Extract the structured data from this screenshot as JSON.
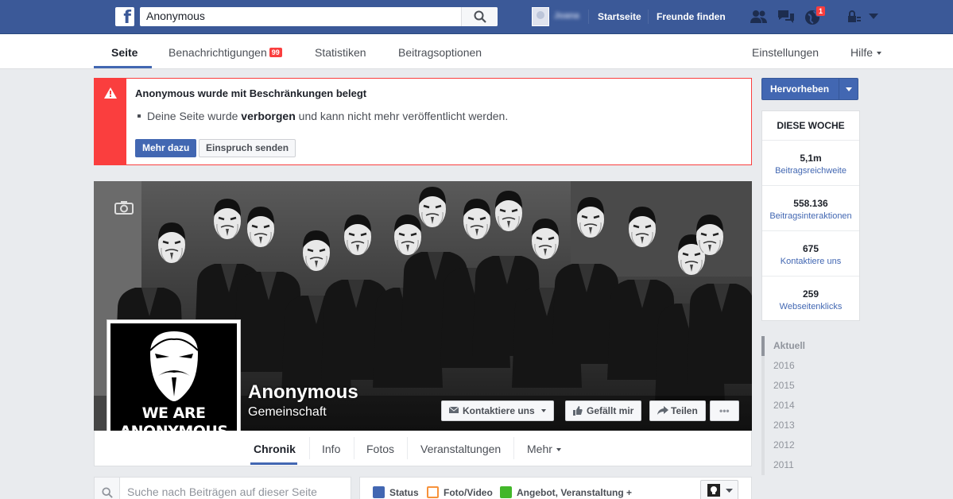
{
  "topbar": {
    "search_value": "Anonymous",
    "user_name": "Joana",
    "nav_home": "Startseite",
    "nav_friends": "Freunde finden",
    "notif_count": "1"
  },
  "page_nav": {
    "tabs": [
      {
        "label": "Seite"
      },
      {
        "label": "Benachrichtigungen",
        "badge": "99"
      },
      {
        "label": "Statistiken"
      },
      {
        "label": "Beitragsoptionen"
      }
    ],
    "settings": "Einstellungen",
    "help": "Hilfe"
  },
  "alert": {
    "title": "Anonymous wurde mit Beschränkungen belegt",
    "text_before": "Deine Seite wurde ",
    "text_bold": "verborgen",
    "text_after": " und kann nicht mehr veröffentlicht werden.",
    "more_button": "Mehr dazu",
    "appeal_button": "Einspruch senden"
  },
  "profile": {
    "picture_text_line1": "WE ARE",
    "picture_text_line2": "ANONYMOUS",
    "name": "Anonymous",
    "category": "Gemeinschaft"
  },
  "cover_actions": {
    "contact": "Kontaktiere uns",
    "like": "Gefällt mir",
    "share": "Teilen",
    "more": "•••"
  },
  "page_tabs": [
    "Chronik",
    "Info",
    "Fotos",
    "Veranstaltungen",
    "Mehr"
  ],
  "search_posts": {
    "placeholder": "Suche nach Beiträgen auf dieser Seite"
  },
  "composer": {
    "status": "Status",
    "photo": "Foto/Video",
    "offer": "Angebot, Veranstaltung +"
  },
  "promote": {
    "label": "Hervorheben"
  },
  "this_week": {
    "title": "DIESE WOCHE",
    "stats": [
      {
        "value": "5,1m",
        "label": "Beitragsreichweite"
      },
      {
        "value": "558.136",
        "label": "Beitragsinteraktionen"
      },
      {
        "value": "675",
        "label": "Kontaktiere uns"
      },
      {
        "value": "259",
        "label": "Webseitenklicks"
      }
    ]
  },
  "timeline_years": [
    "Aktuell",
    "2016",
    "2015",
    "2014",
    "2013",
    "2012",
    "2011"
  ],
  "colors": {
    "brand": "#3b5998",
    "accent": "#4267b2",
    "alert": "#fa3e3e"
  }
}
